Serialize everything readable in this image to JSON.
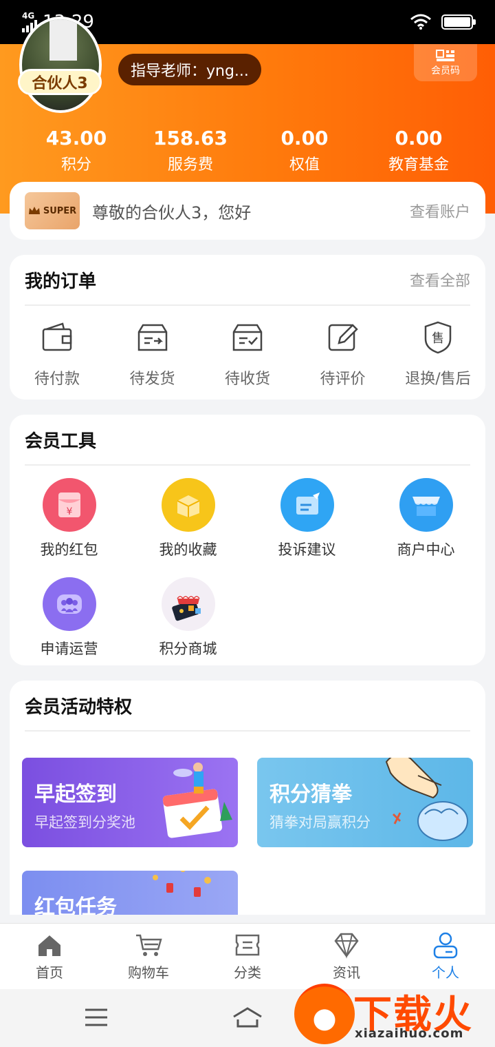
{
  "status_bar": {
    "network": "4G",
    "time": "13:29"
  },
  "profile": {
    "level_badge": "合伙人3",
    "teacher": "指导老师：yng...",
    "qr_label": "会员码"
  },
  "stats": [
    {
      "value": "43.00",
      "label": "积分"
    },
    {
      "value": "158.63",
      "label": "服务费"
    },
    {
      "value": "0.00",
      "label": "权值"
    },
    {
      "value": "0.00",
      "label": "教育基金"
    }
  ],
  "greeting": {
    "badge": "SUPER",
    "text": "尊敬的合伙人3，您好",
    "link": "查看账户"
  },
  "orders": {
    "title": "我的订单",
    "link": "查看全部",
    "items": [
      {
        "label": "待付款",
        "icon": "wallet-icon"
      },
      {
        "label": "待发货",
        "icon": "ship-box-icon"
      },
      {
        "label": "待收货",
        "icon": "receive-box-icon"
      },
      {
        "label": "待评价",
        "icon": "review-edit-icon"
      },
      {
        "label": "退换/售后",
        "icon": "after-sale-shield-icon"
      }
    ]
  },
  "tools": {
    "title": "会员工具",
    "items": [
      {
        "label": "我的红包",
        "icon": "red-envelope-icon",
        "color": "#f2566e"
      },
      {
        "label": "我的收藏",
        "icon": "favorite-box-icon",
        "color": "#f7c51a"
      },
      {
        "label": "投诉建议",
        "icon": "feedback-icon",
        "color": "#2fa5f4"
      },
      {
        "label": "商户中心",
        "icon": "store-icon",
        "color": "#2f9ff2"
      },
      {
        "label": "申请运营",
        "icon": "team-icon",
        "color": "#8b6ef0"
      },
      {
        "label": "积分商城",
        "icon": "points-mall-icon",
        "color": "#f3eef5"
      }
    ]
  },
  "privileges": {
    "title": "会员活动特权",
    "promos": [
      {
        "title": "早起签到",
        "subtitle": "早起签到分奖池"
      },
      {
        "title": "积分猜拳",
        "subtitle": "猜拳对局赢积分"
      },
      {
        "title": "红包任务",
        "subtitle": ""
      }
    ]
  },
  "tabbar": [
    {
      "label": "首页",
      "icon": "home-icon"
    },
    {
      "label": "购物车",
      "icon": "cart-icon"
    },
    {
      "label": "分类",
      "icon": "category-icon"
    },
    {
      "label": "资讯",
      "icon": "diamond-icon"
    },
    {
      "label": "个人",
      "icon": "person-icon",
      "active": true
    }
  ],
  "watermark": {
    "text": "下载火",
    "url": "xiazaihuo.com"
  },
  "colors": {
    "brand_orange": "#ff7a0c",
    "active_blue": "#1e80e6"
  }
}
